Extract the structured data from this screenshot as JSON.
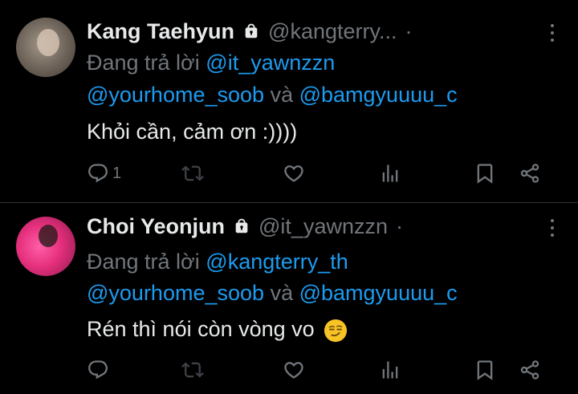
{
  "tweets": [
    {
      "name": "Kang Taehyun",
      "handle": "@kangterry...",
      "replying_prefix": "Đang trả lời",
      "replying_to_1": "@it_yawnzzn",
      "replying_to_2": "@yourhome_soob",
      "replying_and": "và",
      "replying_to_3": "@bamgyuuuu_c",
      "text": "Khỏi cần, cảm ơn :))))",
      "reply_count": "1"
    },
    {
      "name": "Choi Yeonjun",
      "handle": "@it_yawnzzn",
      "replying_prefix": "Đang trả lời",
      "replying_to_1": "@kangterry_th",
      "replying_to_2": "@yourhome_soob",
      "replying_and": "và",
      "replying_to_3": "@bamgyuuuu_c",
      "text": "Rén thì nói còn vòng vo",
      "reply_count": ""
    }
  ],
  "icons": {
    "more": "more-vertical-icon",
    "lock": "lock-icon",
    "reply": "reply-icon",
    "retweet": "retweet-icon",
    "like": "heart-icon",
    "views": "views-icon",
    "bookmark": "bookmark-icon",
    "share": "share-icon",
    "emoji": "smirk-emoji"
  },
  "colors": {
    "background": "#000000",
    "text": "#e7e9ea",
    "muted": "#71767b",
    "link": "#1d9bf0"
  }
}
